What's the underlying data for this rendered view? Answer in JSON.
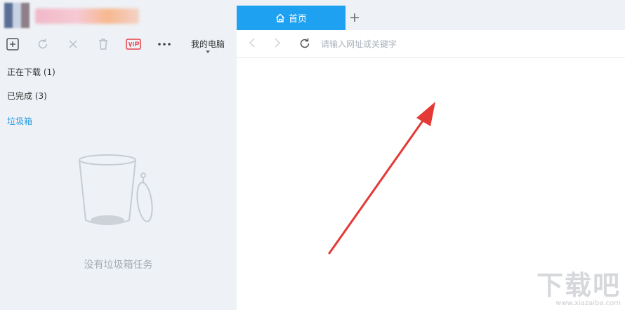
{
  "toolbar": {
    "location_label": "我的电脑"
  },
  "sidebar": {
    "items": [
      {
        "label": "正在下载 (1)"
      },
      {
        "label": "已完成 (3)"
      },
      {
        "label": "垃圾箱"
      }
    ],
    "empty_message": "没有垃圾箱任务"
  },
  "tabs": [
    {
      "label": "首页",
      "active": true
    }
  ],
  "address": {
    "placeholder": "请输入网址或关键字"
  },
  "icons": [
    "new-task-icon",
    "refresh-task-icon",
    "delete-icon",
    "trash-icon",
    "vip-icon",
    "more-icon",
    "home-icon",
    "plus-icon",
    "back-icon",
    "forward-icon",
    "reload-icon",
    "arrow-annotation",
    "trash-can-illustration"
  ],
  "colors": {
    "accent": "#1ea1f1",
    "active_link": "#2a9ee6",
    "vip": "#e8414a",
    "annotation_arrow": "#e53935"
  },
  "watermark": {
    "main": "下载吧",
    "sub": "www.xiazaiba.com"
  }
}
